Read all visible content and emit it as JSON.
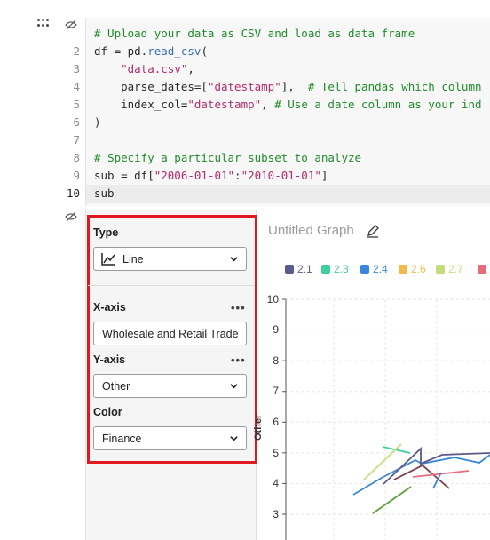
{
  "code": {
    "line_numbers": [
      "2",
      "3",
      "4",
      "5",
      "6",
      "7",
      "8",
      "9",
      "10"
    ],
    "lines": [
      [
        {
          "t": "# Upload your data as CSV and load as data frame",
          "c": "c-com"
        }
      ],
      [
        {
          "t": "df = pd.",
          "c": "c-txt"
        },
        {
          "t": "read_csv",
          "c": "c-fn"
        },
        {
          "t": "(",
          "c": "c-txt"
        }
      ],
      [
        {
          "t": "    ",
          "c": "c-txt"
        },
        {
          "t": "\"data.csv\"",
          "c": "c-str"
        },
        {
          "t": ",",
          "c": "c-txt"
        }
      ],
      [
        {
          "t": "    parse_dates=[",
          "c": "c-txt"
        },
        {
          "t": "\"datestamp\"",
          "c": "c-str"
        },
        {
          "t": "],  ",
          "c": "c-txt"
        },
        {
          "t": "# Tell pandas which column",
          "c": "c-com"
        }
      ],
      [
        {
          "t": "    index_col=",
          "c": "c-txt"
        },
        {
          "t": "\"datestamp\"",
          "c": "c-str"
        },
        {
          "t": ", ",
          "c": "c-txt"
        },
        {
          "t": "# Use a date column as your ind",
          "c": "c-com"
        }
      ],
      [
        {
          "t": ")",
          "c": "c-txt"
        }
      ],
      [
        {
          "t": "",
          "c": "c-txt"
        }
      ],
      [
        {
          "t": "# Specify a particular subset to analyze",
          "c": "c-com"
        }
      ],
      [
        {
          "t": "sub = df[",
          "c": "c-txt"
        },
        {
          "t": "\"2006-01-01\"",
          "c": "c-str"
        },
        {
          "t": ":",
          "c": "c-txt"
        },
        {
          "t": "\"2010-01-01\"",
          "c": "c-str"
        },
        {
          "t": "]",
          "c": "c-txt"
        }
      ],
      [
        {
          "t": "sub",
          "c": "c-txt"
        }
      ]
    ]
  },
  "config": {
    "type_label": "Type",
    "type_value": "Line",
    "xaxis_label": "X-axis",
    "xaxis_value": "Wholesale and Retail Trade",
    "yaxis_label": "Y-axis",
    "yaxis_value": "Other",
    "color_label": "Color",
    "color_value": "Finance",
    "more_glyph": "•••"
  },
  "graph": {
    "title": "Untitled Graph",
    "ylabel": "Other",
    "yticks": [
      "10",
      "9",
      "8",
      "7",
      "6",
      "5",
      "4",
      "3"
    ]
  },
  "chart_data": {
    "type": "line",
    "title": "Untitled Graph",
    "xlabel": "Wholesale and Retail Trade",
    "ylabel": "Other",
    "ylim": [
      3,
      10
    ],
    "grid": true,
    "legend_position": "top",
    "series": [
      {
        "name": "2.1",
        "color": "#5c5a8c",
        "values": []
      },
      {
        "name": "2.3",
        "color": "#3ecf9a",
        "values": []
      },
      {
        "name": "2.4",
        "color": "#3a86d6",
        "values": []
      },
      {
        "name": "2.6",
        "color": "#f3b94b",
        "values": []
      },
      {
        "name": "2.7",
        "color": "#c4dc7a",
        "values": []
      },
      {
        "name": "",
        "color": "#e86b7b",
        "values": []
      }
    ]
  },
  "colors": {
    "highlight": "#e0181f"
  }
}
